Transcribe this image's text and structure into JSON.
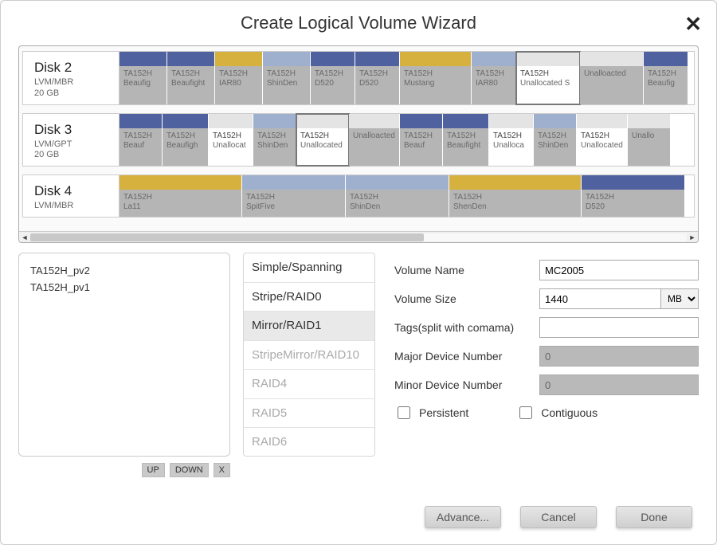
{
  "title": "Create Logical Volume Wizard",
  "disks": [
    {
      "name": "Disk 2",
      "meta": "LVM/MBR\n20 GB",
      "parts": [
        {
          "w": 60,
          "top": "blue",
          "body": "dark",
          "l1": "TA152H",
          "l2": "Beaufig"
        },
        {
          "w": 60,
          "top": "blue",
          "body": "dark",
          "l1": "TA152H",
          "l2": "Beaufight"
        },
        {
          "w": 60,
          "top": "yellow",
          "body": "dark",
          "l1": "TA152H",
          "l2": "IAR80"
        },
        {
          "w": 60,
          "top": "lblue",
          "body": "dark",
          "l1": "TA152H",
          "l2": "ShinDen"
        },
        {
          "w": 56,
          "top": "blue",
          "body": "dark",
          "l1": "TA152H",
          "l2": "D520"
        },
        {
          "w": 56,
          "top": "blue",
          "body": "dark",
          "l1": "TA152H",
          "l2": "D520"
        },
        {
          "w": 90,
          "top": "yellow",
          "body": "dark",
          "l1": "TA152H",
          "l2": "Mustang"
        },
        {
          "w": 56,
          "top": "lblue",
          "body": "dark",
          "l1": "TA152H",
          "l2": "IAR80"
        },
        {
          "w": 80,
          "top": "grey",
          "body": "white",
          "l1": "TA152H",
          "l2": "Unallocated S",
          "sel": true
        },
        {
          "w": 80,
          "top": "grey",
          "body": "dark",
          "l1": "Unalloacted",
          "l2": ""
        },
        {
          "w": 56,
          "top": "blue",
          "body": "dark",
          "l1": "TA152H",
          "l2": "Beaufig"
        }
      ]
    },
    {
      "name": "Disk 3",
      "meta": "LVM/GPT\n20 GB",
      "parts": [
        {
          "w": 46,
          "top": "blue",
          "body": "dark",
          "l1": "TA152H",
          "l2": "Beauf"
        },
        {
          "w": 58,
          "top": "blue",
          "body": "dark",
          "l1": "TA152H",
          "l2": "Beaufigh"
        },
        {
          "w": 56,
          "top": "grey",
          "body": "white",
          "l1": "TA152H",
          "l2": "Unallocat"
        },
        {
          "w": 50,
          "top": "lblue",
          "body": "dark",
          "l1": "TA152H",
          "l2": "ShinDen"
        },
        {
          "w": 66,
          "top": "grey",
          "body": "white",
          "l1": "TA152H",
          "l2": "Unallocated",
          "sel": true
        },
        {
          "w": 64,
          "top": "grey",
          "body": "dark",
          "l1": "Unalloacted",
          "l2": ""
        },
        {
          "w": 44,
          "top": "blue",
          "body": "dark",
          "l1": "TA152H",
          "l2": "Beauf"
        },
        {
          "w": 58,
          "top": "blue",
          "body": "dark",
          "l1": "TA152H",
          "l2": "Beaufight"
        },
        {
          "w": 56,
          "top": "grey",
          "body": "white",
          "l1": "TA152H",
          "l2": "Unalloca"
        },
        {
          "w": 50,
          "top": "lblue",
          "body": "dark",
          "l1": "TA152H",
          "l2": "ShinDen"
        },
        {
          "w": 64,
          "top": "grey",
          "body": "white",
          "l1": "TA152H",
          "l2": "Unallocated"
        },
        {
          "w": 50,
          "top": "grey",
          "body": "dark",
          "l1": "Unallo",
          "l2": ""
        }
      ]
    },
    {
      "name": "Disk 4",
      "meta": "LVM/MBR",
      "parts": [
        {
          "w": 154,
          "top": "yellow",
          "body": "dark",
          "l1": "TA152H",
          "l2": "La11"
        },
        {
          "w": 130,
          "top": "lblue",
          "body": "dark",
          "l1": "TA152H",
          "l2": "SpitFive"
        },
        {
          "w": 130,
          "top": "lblue",
          "body": "dark",
          "l1": "TA152H",
          "l2": "ShinDen"
        },
        {
          "w": 166,
          "top": "yellow",
          "body": "dark",
          "l1": "TA152H",
          "l2": "ShenDen"
        },
        {
          "w": 130,
          "top": "blue",
          "body": "dark",
          "l1": "TA152H",
          "l2": "D520"
        }
      ]
    }
  ],
  "pvs": [
    "TA152H_pv2",
    "TA152H_pv1"
  ],
  "pvBtns": {
    "up": "UP",
    "down": "DOWN",
    "remove": "X"
  },
  "raidLevels": [
    {
      "label": "Simple/Spanning",
      "state": "normal"
    },
    {
      "label": "Stripe/RAID0",
      "state": "normal"
    },
    {
      "label": "Mirror/RAID1",
      "state": "selected"
    },
    {
      "label": "StripeMirror/RAID10",
      "state": "disabled"
    },
    {
      "label": "RAID4",
      "state": "disabled"
    },
    {
      "label": "RAID5",
      "state": "disabled"
    },
    {
      "label": "RAID6",
      "state": "disabled"
    }
  ],
  "form": {
    "volumeName": {
      "label": "Volume Name",
      "value": "MC2005"
    },
    "volumeSize": {
      "label": "Volume Size",
      "value": "1440",
      "unit": "MB"
    },
    "tags": {
      "label": "Tags(split with comama)",
      "value": ""
    },
    "major": {
      "label": "Major Device Number",
      "value": "0"
    },
    "minor": {
      "label": "Minor Device Number",
      "value": "0"
    },
    "persistent": {
      "label": "Persistent",
      "checked": false
    },
    "contiguous": {
      "label": "Contiguous",
      "checked": false
    }
  },
  "footer": {
    "advance": "Advance...",
    "cancel": "Cancel",
    "done": "Done"
  }
}
